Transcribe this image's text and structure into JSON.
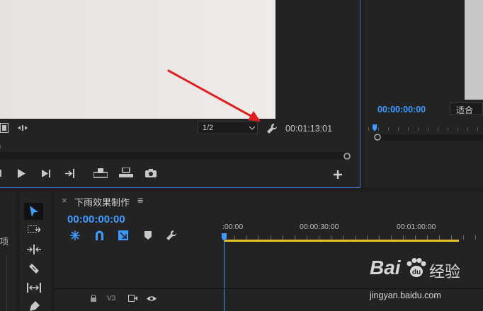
{
  "program_monitor": {
    "resolution": "1/2",
    "timecode": "00:01:13:01"
  },
  "source_monitor": {
    "timecode": "00:00:00:00",
    "fit": "适合"
  },
  "timeline": {
    "close_glyph": "×",
    "sequence_name": "下雨效果制作",
    "menu_glyph": "≡",
    "current_time": "00:00:00:00",
    "ruler_labels": [
      ":00:00",
      "00:00:30:00",
      "00:01:00:00"
    ],
    "track": {
      "label": "V3"
    }
  },
  "left_panel": {
    "partial_label": "项"
  },
  "watermark": {
    "brand": "Bai",
    "brand_paw": "du",
    "brand_cn": "经验",
    "url": "jingyan.baidu.com"
  },
  "colors": {
    "accent_blue": "#3e9bff",
    "workarea_yellow": "#e6c229",
    "annotation_red": "#e02020",
    "panel_bg": "#232323"
  },
  "icons": [
    "film-icon",
    "marker-arrows-icon",
    "wrench-icon",
    "step-back-icon",
    "play-icon",
    "step-forward-icon",
    "go-to-out-icon",
    "lift-icon",
    "extract-icon",
    "camera-icon",
    "add-icon",
    "selection-tool-icon",
    "track-select-tool-icon",
    "ripple-edit-tool-icon",
    "razor-tool-icon",
    "slip-tool-icon",
    "pen-tool-icon",
    "nest-icon",
    "snap-icon",
    "linked-selection-icon",
    "add-marker-icon",
    "timeline-settings-icon",
    "lock-icon",
    "toggle-output-icon",
    "eye-icon"
  ]
}
